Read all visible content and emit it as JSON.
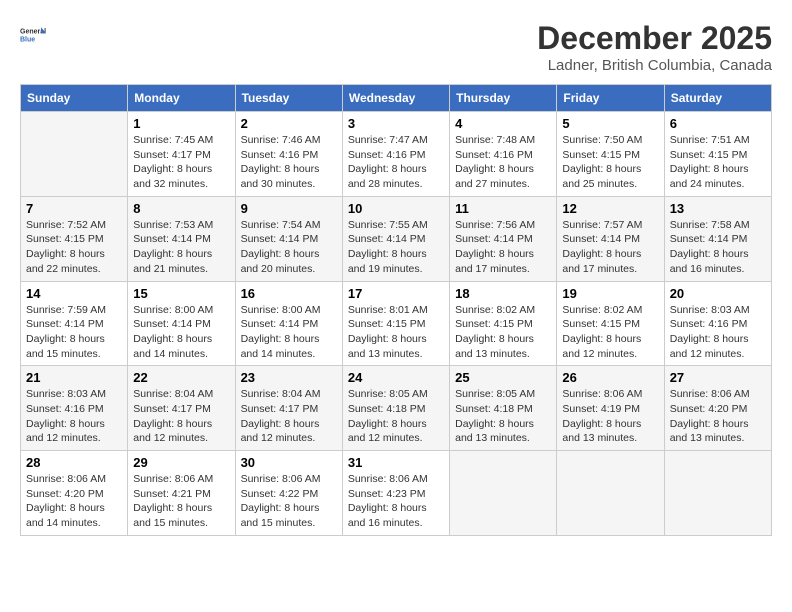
{
  "header": {
    "logo_line1": "General",
    "logo_line2": "Blue",
    "month_title": "December 2025",
    "location": "Ladner, British Columbia, Canada"
  },
  "weekdays": [
    "Sunday",
    "Monday",
    "Tuesday",
    "Wednesday",
    "Thursday",
    "Friday",
    "Saturday"
  ],
  "weeks": [
    [
      {
        "day": "",
        "sunrise": "",
        "sunset": "",
        "daylight": ""
      },
      {
        "day": "1",
        "sunrise": "Sunrise: 7:45 AM",
        "sunset": "Sunset: 4:17 PM",
        "daylight": "Daylight: 8 hours and 32 minutes."
      },
      {
        "day": "2",
        "sunrise": "Sunrise: 7:46 AM",
        "sunset": "Sunset: 4:16 PM",
        "daylight": "Daylight: 8 hours and 30 minutes."
      },
      {
        "day": "3",
        "sunrise": "Sunrise: 7:47 AM",
        "sunset": "Sunset: 4:16 PM",
        "daylight": "Daylight: 8 hours and 28 minutes."
      },
      {
        "day": "4",
        "sunrise": "Sunrise: 7:48 AM",
        "sunset": "Sunset: 4:16 PM",
        "daylight": "Daylight: 8 hours and 27 minutes."
      },
      {
        "day": "5",
        "sunrise": "Sunrise: 7:50 AM",
        "sunset": "Sunset: 4:15 PM",
        "daylight": "Daylight: 8 hours and 25 minutes."
      },
      {
        "day": "6",
        "sunrise": "Sunrise: 7:51 AM",
        "sunset": "Sunset: 4:15 PM",
        "daylight": "Daylight: 8 hours and 24 minutes."
      }
    ],
    [
      {
        "day": "7",
        "sunrise": "Sunrise: 7:52 AM",
        "sunset": "Sunset: 4:15 PM",
        "daylight": "Daylight: 8 hours and 22 minutes."
      },
      {
        "day": "8",
        "sunrise": "Sunrise: 7:53 AM",
        "sunset": "Sunset: 4:14 PM",
        "daylight": "Daylight: 8 hours and 21 minutes."
      },
      {
        "day": "9",
        "sunrise": "Sunrise: 7:54 AM",
        "sunset": "Sunset: 4:14 PM",
        "daylight": "Daylight: 8 hours and 20 minutes."
      },
      {
        "day": "10",
        "sunrise": "Sunrise: 7:55 AM",
        "sunset": "Sunset: 4:14 PM",
        "daylight": "Daylight: 8 hours and 19 minutes."
      },
      {
        "day": "11",
        "sunrise": "Sunrise: 7:56 AM",
        "sunset": "Sunset: 4:14 PM",
        "daylight": "Daylight: 8 hours and 17 minutes."
      },
      {
        "day": "12",
        "sunrise": "Sunrise: 7:57 AM",
        "sunset": "Sunset: 4:14 PM",
        "daylight": "Daylight: 8 hours and 17 minutes."
      },
      {
        "day": "13",
        "sunrise": "Sunrise: 7:58 AM",
        "sunset": "Sunset: 4:14 PM",
        "daylight": "Daylight: 8 hours and 16 minutes."
      }
    ],
    [
      {
        "day": "14",
        "sunrise": "Sunrise: 7:59 AM",
        "sunset": "Sunset: 4:14 PM",
        "daylight": "Daylight: 8 hours and 15 minutes."
      },
      {
        "day": "15",
        "sunrise": "Sunrise: 8:00 AM",
        "sunset": "Sunset: 4:14 PM",
        "daylight": "Daylight: 8 hours and 14 minutes."
      },
      {
        "day": "16",
        "sunrise": "Sunrise: 8:00 AM",
        "sunset": "Sunset: 4:14 PM",
        "daylight": "Daylight: 8 hours and 14 minutes."
      },
      {
        "day": "17",
        "sunrise": "Sunrise: 8:01 AM",
        "sunset": "Sunset: 4:15 PM",
        "daylight": "Daylight: 8 hours and 13 minutes."
      },
      {
        "day": "18",
        "sunrise": "Sunrise: 8:02 AM",
        "sunset": "Sunset: 4:15 PM",
        "daylight": "Daylight: 8 hours and 13 minutes."
      },
      {
        "day": "19",
        "sunrise": "Sunrise: 8:02 AM",
        "sunset": "Sunset: 4:15 PM",
        "daylight": "Daylight: 8 hours and 12 minutes."
      },
      {
        "day": "20",
        "sunrise": "Sunrise: 8:03 AM",
        "sunset": "Sunset: 4:16 PM",
        "daylight": "Daylight: 8 hours and 12 minutes."
      }
    ],
    [
      {
        "day": "21",
        "sunrise": "Sunrise: 8:03 AM",
        "sunset": "Sunset: 4:16 PM",
        "daylight": "Daylight: 8 hours and 12 minutes."
      },
      {
        "day": "22",
        "sunrise": "Sunrise: 8:04 AM",
        "sunset": "Sunset: 4:17 PM",
        "daylight": "Daylight: 8 hours and 12 minutes."
      },
      {
        "day": "23",
        "sunrise": "Sunrise: 8:04 AM",
        "sunset": "Sunset: 4:17 PM",
        "daylight": "Daylight: 8 hours and 12 minutes."
      },
      {
        "day": "24",
        "sunrise": "Sunrise: 8:05 AM",
        "sunset": "Sunset: 4:18 PM",
        "daylight": "Daylight: 8 hours and 12 minutes."
      },
      {
        "day": "25",
        "sunrise": "Sunrise: 8:05 AM",
        "sunset": "Sunset: 4:18 PM",
        "daylight": "Daylight: 8 hours and 13 minutes."
      },
      {
        "day": "26",
        "sunrise": "Sunrise: 8:06 AM",
        "sunset": "Sunset: 4:19 PM",
        "daylight": "Daylight: 8 hours and 13 minutes."
      },
      {
        "day": "27",
        "sunrise": "Sunrise: 8:06 AM",
        "sunset": "Sunset: 4:20 PM",
        "daylight": "Daylight: 8 hours and 13 minutes."
      }
    ],
    [
      {
        "day": "28",
        "sunrise": "Sunrise: 8:06 AM",
        "sunset": "Sunset: 4:20 PM",
        "daylight": "Daylight: 8 hours and 14 minutes."
      },
      {
        "day": "29",
        "sunrise": "Sunrise: 8:06 AM",
        "sunset": "Sunset: 4:21 PM",
        "daylight": "Daylight: 8 hours and 15 minutes."
      },
      {
        "day": "30",
        "sunrise": "Sunrise: 8:06 AM",
        "sunset": "Sunset: 4:22 PM",
        "daylight": "Daylight: 8 hours and 15 minutes."
      },
      {
        "day": "31",
        "sunrise": "Sunrise: 8:06 AM",
        "sunset": "Sunset: 4:23 PM",
        "daylight": "Daylight: 8 hours and 16 minutes."
      },
      {
        "day": "",
        "sunrise": "",
        "sunset": "",
        "daylight": ""
      },
      {
        "day": "",
        "sunrise": "",
        "sunset": "",
        "daylight": ""
      },
      {
        "day": "",
        "sunrise": "",
        "sunset": "",
        "daylight": ""
      }
    ]
  ]
}
